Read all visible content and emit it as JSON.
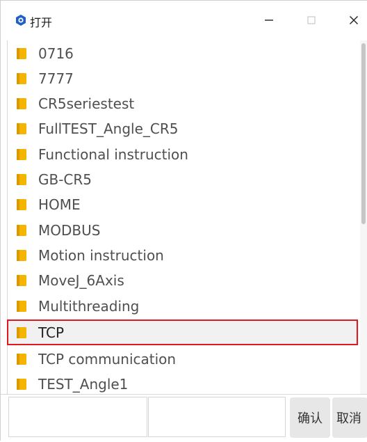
{
  "window": {
    "title": "打开",
    "controls": {
      "minimize": "–",
      "maximize": "□",
      "close": "×"
    }
  },
  "files": [
    {
      "name": "0716",
      "selected": false
    },
    {
      "name": "7777",
      "selected": false
    },
    {
      "name": "CR5seriestest",
      "selected": false
    },
    {
      "name": "FullTEST_Angle_CR5",
      "selected": false
    },
    {
      "name": "Functional instruction",
      "selected": false
    },
    {
      "name": "GB-CR5",
      "selected": false
    },
    {
      "name": "HOME",
      "selected": false
    },
    {
      "name": "MODBUS",
      "selected": false
    },
    {
      "name": "Motion instruction",
      "selected": false
    },
    {
      "name": "MoveJ_6Axis",
      "selected": false
    },
    {
      "name": "Multithreading",
      "selected": false
    },
    {
      "name": "TCP",
      "selected": true
    },
    {
      "name": "TCP communication",
      "selected": false
    },
    {
      "name": "TEST_Angle1",
      "selected": false
    }
  ],
  "footer": {
    "name_value": "",
    "filter_value": "",
    "confirm_label": "确认",
    "cancel_label": "取消"
  },
  "colors": {
    "folder": "#f5b400",
    "highlight": "#e0191e",
    "app_icon": "#1f5fc7"
  },
  "icons": {
    "app": "app-logo-icon",
    "folder": "folder-icon",
    "minimize": "minimize-icon",
    "maximize": "maximize-icon",
    "close": "close-icon"
  }
}
